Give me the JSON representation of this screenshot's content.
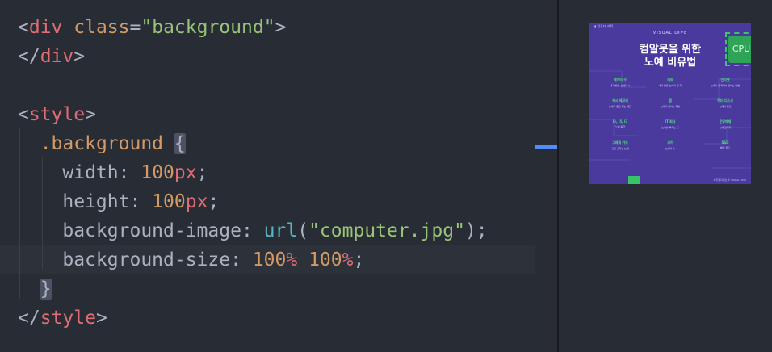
{
  "code": {
    "lines": [
      [
        {
          "t": "<",
          "c": "punct"
        },
        {
          "t": "div",
          "c": "tag"
        },
        {
          "t": " ",
          "c": "punct"
        },
        {
          "t": "class",
          "c": "attr"
        },
        {
          "t": "=",
          "c": "punct"
        },
        {
          "t": "\"background\"",
          "c": "str"
        },
        {
          "t": ">",
          "c": "punct"
        }
      ],
      [
        {
          "t": "</",
          "c": "punct"
        },
        {
          "t": "div",
          "c": "tag"
        },
        {
          "t": ">",
          "c": "punct"
        }
      ],
      [],
      [
        {
          "t": "<",
          "c": "punct"
        },
        {
          "t": "style",
          "c": "tag"
        },
        {
          "t": ">",
          "c": "punct"
        }
      ],
      [
        {
          "t": "  ",
          "c": "punct"
        },
        {
          "t": ".background",
          "c": "cls"
        },
        {
          "t": " ",
          "c": "punct"
        },
        {
          "t": "{",
          "c": "punct",
          "hl": true
        }
      ],
      [
        {
          "t": "    ",
          "c": "punct"
        },
        {
          "t": "width",
          "c": "prop"
        },
        {
          "t": ": ",
          "c": "punct"
        },
        {
          "t": "100",
          "c": "num"
        },
        {
          "t": "px",
          "c": "unit"
        },
        {
          "t": ";",
          "c": "punct"
        }
      ],
      [
        {
          "t": "    ",
          "c": "punct"
        },
        {
          "t": "height",
          "c": "prop"
        },
        {
          "t": ": ",
          "c": "punct"
        },
        {
          "t": "100",
          "c": "num"
        },
        {
          "t": "px",
          "c": "unit"
        },
        {
          "t": ";",
          "c": "punct"
        }
      ],
      [
        {
          "t": "    ",
          "c": "punct"
        },
        {
          "t": "background-image",
          "c": "prop"
        },
        {
          "t": ": ",
          "c": "punct"
        },
        {
          "t": "url",
          "c": "fn"
        },
        {
          "t": "(",
          "c": "punct"
        },
        {
          "t": "\"computer.jpg\"",
          "c": "str"
        },
        {
          "t": ");",
          "c": "punct"
        }
      ],
      [
        {
          "t": "    ",
          "c": "punct"
        },
        {
          "t": "background-size",
          "c": "prop"
        },
        {
          "t": ": ",
          "c": "punct"
        },
        {
          "t": "100",
          "c": "num"
        },
        {
          "t": "%",
          "c": "unit"
        },
        {
          "t": " ",
          "c": "punct"
        },
        {
          "t": "100",
          "c": "num"
        },
        {
          "t": "%",
          "c": "unit"
        },
        {
          "t": ";",
          "c": "punct"
        }
      ],
      [
        {
          "t": "  ",
          "c": "punct"
        },
        {
          "t": "}",
          "c": "punct",
          "hl": true
        }
      ],
      [
        {
          "t": "</",
          "c": "punct"
        },
        {
          "t": "style",
          "c": "tag"
        },
        {
          "t": ">",
          "c": "punct"
        }
      ]
    ],
    "active_line": 8
  },
  "poster": {
    "caption": "▮ 컴퓨터 과학",
    "subtitle": "VISUAL DIVE",
    "title_line1": "컴알못을 위한",
    "title_line2": "노예 비유법",
    "chip_label": "CPU",
    "cells": [
      {
        "h": "데이터 수",
        "d": "내가 받은 노예의 수"
      },
      {
        "h": "비트",
        "d": "내가 받은 노예의 한 자"
      },
      {
        "h": "인터넷",
        "d": "노예가 원격에서 일하는 방법"
      },
      {
        "h": "캐시 메모리",
        "d": "노예가 들고 있는 메모"
      },
      {
        "h": "램",
        "d": "노예가 일하는 책상"
      },
      {
        "h": "하드 디스크",
        "d": "노예의 창고"
      },
      {
        "h": "I3, I5, I7",
        "d": "노예 등급"
      },
      {
        "h": "IT 회사",
        "d": "노예를 부리는 곳"
      },
      {
        "h": "운영체제",
        "d": "노예 관리자"
      },
      {
        "h": "그래픽 카드",
        "d": "그림 그리는 노예"
      },
      {
        "h": "코어",
        "d": "노예의 수"
      },
      {
        "h": "SSD",
        "d": "빠른 창고"
      },
      {
        "h": "",
        "d": ""
      },
      {
        "h": "",
        "d": ""
      },
      {
        "h": "",
        "d": ""
      }
    ],
    "footer": "비주얼다이브 © VISUAL DIVE"
  },
  "colors": {
    "editor_bg": "#282c34",
    "active_line_bg": "#2c313a",
    "tag": "#e06c75",
    "string": "#98c379",
    "number": "#d19a66",
    "function": "#56b6c2",
    "poster_bg": "#4a3a9e",
    "poster_accent": "#4ee07e"
  }
}
